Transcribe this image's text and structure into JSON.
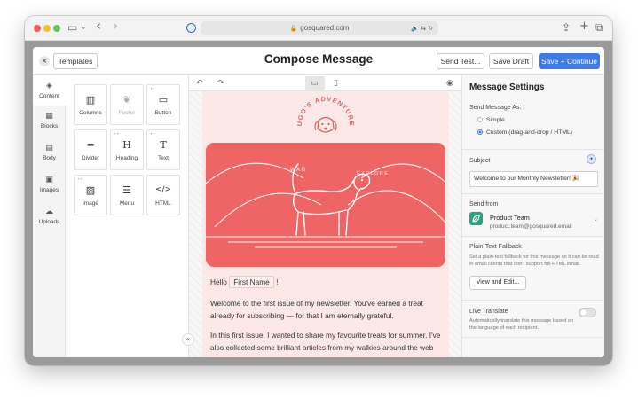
{
  "browser": {
    "url": "gosquared.com",
    "toolbar_icons": [
      "sidebar-icon",
      "chevron-down-icon",
      "back-icon",
      "forward-icon",
      "share-icon",
      "new-tab-icon",
      "tabs-icon"
    ],
    "sidebar_glyph": "▭",
    "dropdown_glyph": "⌄",
    "back_glyph": "‹",
    "forward_glyph": "›",
    "share_glyph": "⇪",
    "new_tab_glyph": "+",
    "tabs_glyph": "⧉",
    "address_right_glyphs": "🔈 ⇆ ↻",
    "lock_glyph": "🔒"
  },
  "modal": {
    "close_glyph": "×",
    "templates_label": "Templates",
    "title": "Compose Message",
    "send_test_label": "Send Test...",
    "save_draft_label": "Save Draft",
    "save_continue_label": "Save + Continue"
  },
  "rail": {
    "items": [
      {
        "label": "Content",
        "icon": "shapes-icon",
        "glyph": "◈"
      },
      {
        "label": "Blocks",
        "icon": "blocks-icon",
        "glyph": "▦"
      },
      {
        "label": "Body",
        "icon": "body-icon",
        "glyph": "▤"
      },
      {
        "label": "Images",
        "icon": "images-icon",
        "glyph": "▣"
      },
      {
        "label": "Uploads",
        "icon": "upload-cloud-icon",
        "glyph": "☁"
      }
    ]
  },
  "blocks": {
    "new_marker": "⁺⁺",
    "tiles": [
      {
        "label": "Columns",
        "icon": "columns-icon",
        "glyph": "▥",
        "state": "normal"
      },
      {
        "label": "Footer",
        "icon": "footer-leaf-icon",
        "glyph": "❦",
        "state": "disabled"
      },
      {
        "label": "Button",
        "icon": "button-icon",
        "glyph": "▭",
        "state": "new"
      },
      {
        "label": "Divider",
        "icon": "divider-icon",
        "glyph": "═",
        "state": "normal"
      },
      {
        "label": "Heading",
        "icon": "heading-icon",
        "glyph": "H",
        "state": "new"
      },
      {
        "label": "Text",
        "icon": "text-icon",
        "glyph": "T",
        "state": "new"
      },
      {
        "label": "Image",
        "icon": "image-icon",
        "glyph": "▨",
        "state": "new"
      },
      {
        "label": "Menu",
        "icon": "menu-icon",
        "glyph": "☰",
        "state": "normal"
      },
      {
        "label": "HTML",
        "icon": "code-icon",
        "glyph": "</>",
        "state": "normal"
      }
    ]
  },
  "canvas": {
    "undo_glyph": "↶",
    "redo_glyph": "↷",
    "desktop_glyph": "▭",
    "mobile_glyph": "▯",
    "preview_glyph": "◉",
    "collapse_glyph": "«",
    "logo_text": "HUGO'S ADVENTURES",
    "hero_text_left": "WAG",
    "hero_text_right": "EXPLORE",
    "greeting_prefix": "Hello",
    "merge_tag": "First Name",
    "greeting_suffix": "!",
    "paragraph_1": "Welcome to the first issue of my newsletter. You've earned a treat already for subscribing — for that I am eternally grateful.",
    "paragraph_2": "In this first issue, I wanted to share my favourite treats for summer. I've also collected some brilliant articles from my walkies around the web this month. Be sure to read to the end for a final treat that is sure to get your"
  },
  "settings": {
    "title": "Message Settings",
    "send_as_label": "Send Message As:",
    "send_as_options": [
      "Simple",
      "Custom (drag-and-drop / HTML)"
    ],
    "send_as_selected": "Custom (drag-and-drop / HTML)",
    "subject_label": "Subject",
    "subject_value": "Welcome to our Monthly Newsletter! 🎉",
    "subject_ai_glyph": "✦",
    "send_from_label": "Send from",
    "sender_name": "Product Team",
    "sender_email": "product.team@gosquared.email",
    "sender_chevron": "⌄",
    "plaintext_label": "Plain-Text Fallback",
    "plaintext_help": "Set a plain-text fallback for this message so it can be read in email clients that don't support full HTML email.",
    "view_edit_label": "View and Edit...",
    "live_translate_label": "Live Translate",
    "live_translate_help": "Automatically translate this message based on the language of each recipient.",
    "live_translate_on": false
  },
  "colors": {
    "accent": "#3d7be8",
    "hero": "#ef6464",
    "email_bg": "#fce8e6",
    "logo": "#e06060",
    "sender": "#2fa07b"
  }
}
